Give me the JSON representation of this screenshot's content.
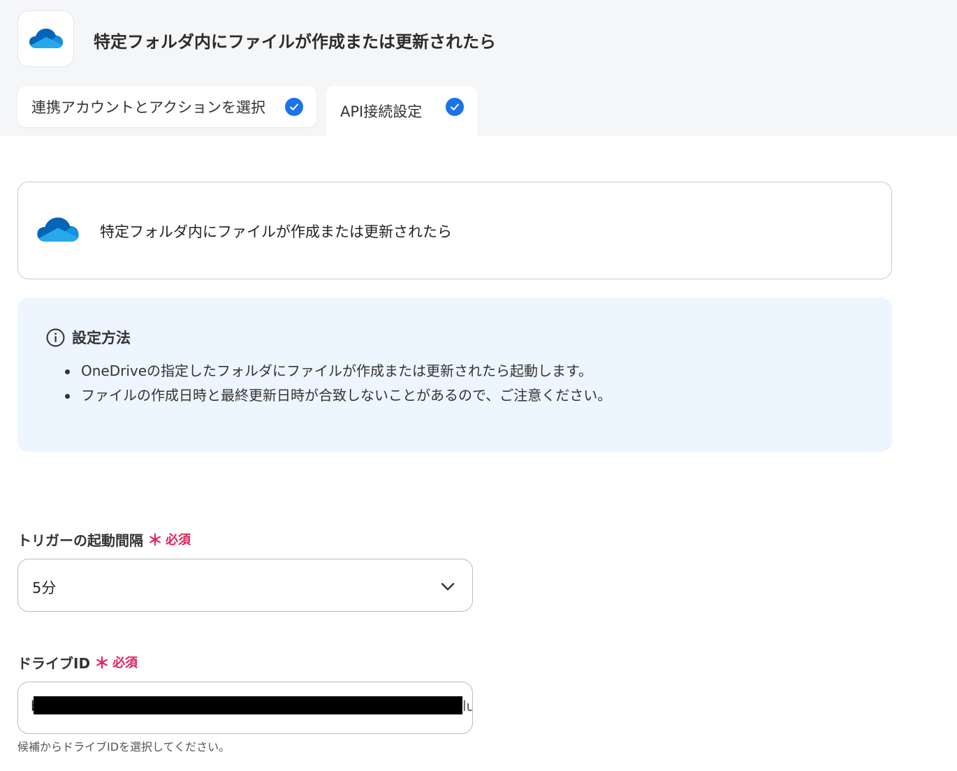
{
  "header": {
    "title": "特定フォルダ内にファイルが作成または更新されたら",
    "app_icon": "onedrive-cloud-icon"
  },
  "tabs": [
    {
      "label": "連携アカウントとアクションを選択",
      "completed": true
    },
    {
      "label": "API接続設定",
      "completed": true,
      "active": true
    }
  ],
  "trigger_card": {
    "label": "特定フォルダ内にファイルが作成または更新されたら"
  },
  "info": {
    "title": "設定方法",
    "items": [
      "OneDriveの指定したフォルダにファイルが作成または更新されたら起動します。",
      "ファイルの作成日時と最終更新日時が合致しないことがあるので、ご注意ください。"
    ]
  },
  "interval_field": {
    "label": "トリガーの起動間隔",
    "required_mark": "＊",
    "required_text": "必須",
    "value": "5分"
  },
  "drive_field": {
    "label": "ドライブID",
    "required_mark": "＊",
    "required_text": "必須",
    "value_prefix": "b",
    "value_suffix": "lu",
    "hint": "候補からドライブIDを選択してください。"
  },
  "colors": {
    "accent": "#1a73e8",
    "required": "#e0245e",
    "info_bg": "#edf5fe",
    "header_bg": "#f5f6f8"
  }
}
